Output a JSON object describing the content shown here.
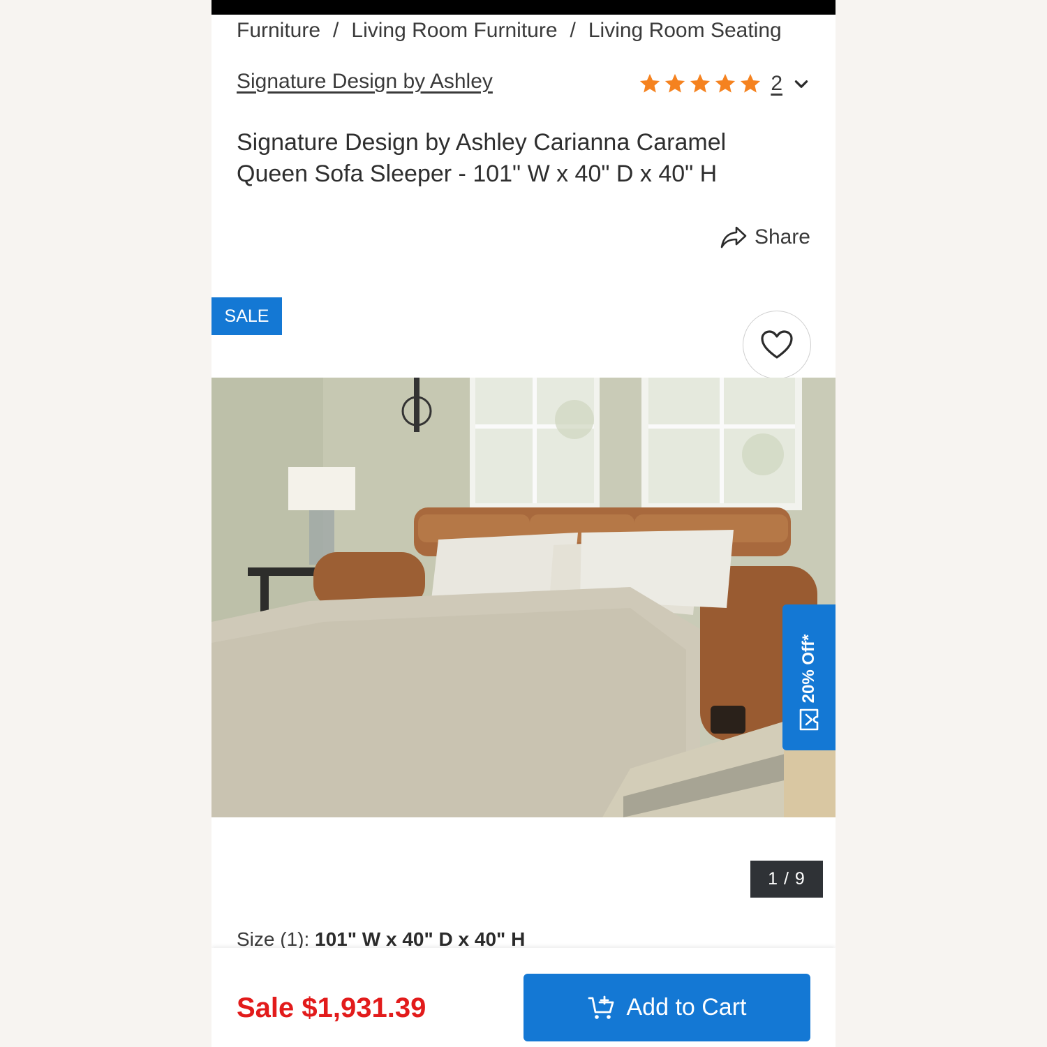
{
  "breadcrumb": {
    "items": [
      "Furniture",
      "Living Room Furniture",
      "Living Room Seating"
    ],
    "separator": "/"
  },
  "brand": {
    "name": "Signature Design by Ashley"
  },
  "rating": {
    "stars": 5,
    "max_stars": 5,
    "count": "2",
    "star_color": "#f5821f"
  },
  "product": {
    "title": "Signature Design by Ashley Carianna Caramel Queen Sofa Sleeper - 101\" W x 40\" D x 40\" H"
  },
  "share": {
    "label": "Share"
  },
  "badge": {
    "label": "SALE",
    "color": "#1478d4"
  },
  "promo": {
    "label": "20% Off*"
  },
  "gallery": {
    "counter": "1 / 9"
  },
  "size": {
    "label": "Size (1):",
    "value": "101\" W x 40\" D x 40\" H"
  },
  "purchase": {
    "price_label": "Sale $1,931.39",
    "price_color": "#e21b1b",
    "cart_label": "Add to Cart",
    "button_color": "#1478d4"
  },
  "icons": [
    "star-icon",
    "chevron-down-icon",
    "share-icon",
    "heart-icon",
    "tag-icon",
    "cart-icon"
  ]
}
